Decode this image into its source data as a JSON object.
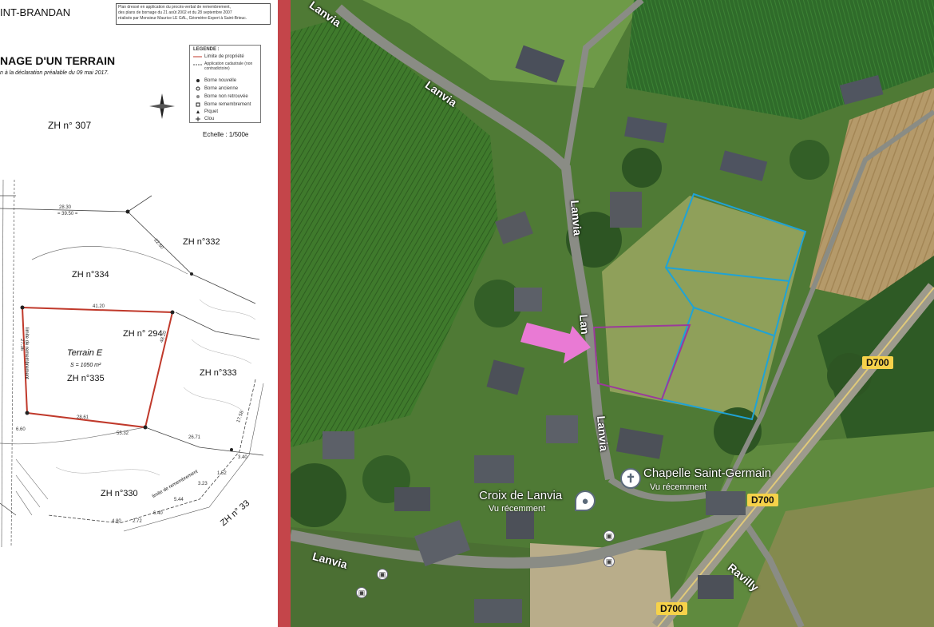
{
  "plan": {
    "commune": "INT-BRANDAN",
    "title": "NAGE D'UN TERRAIN",
    "subtitle": "n à la déclaration préalable du 09 mai 2017.",
    "notice": [
      "Plan dressé en application du procès-verbal de remembrement,",
      "des plans de bornage du 21 août 2002 et du 28 septembre 2007",
      "réalisés par Monsieur Maurice LE GAL, Géomètre-Expert à Saint-Brieuc."
    ],
    "legend_title": "LEGENDE :",
    "legend_items": [
      "Limite de propriété",
      "Application cadastrale (non contradictoire)",
      "Borne nouvelle",
      "Borne ancienne",
      "Borne non retrouvée",
      "Borne remembrement",
      "Piquet",
      "Clou"
    ],
    "scale": "Echelle : 1/500e",
    "parcels": {
      "zh307": "ZH n° 307",
      "zh332": "ZH n°332",
      "zh334": "ZH n°334",
      "zh294": "ZH n° 294",
      "terrain": "Terrain E",
      "surface": "S = 1050 m²",
      "zh335": "ZH n°335",
      "zh333": "ZH n°333",
      "zh330": "ZH n°330",
      "zh33": "ZH n° 33"
    },
    "edge_labels": [
      "limite de remembrement",
      "limite de remembrement"
    ],
    "dims": [
      "28.30",
      "= 39.50 =",
      "41.20",
      "22.50",
      "28.61",
      "55.32",
      "26.71",
      "48.20",
      "27.36",
      "6.60",
      "17.58",
      "1.52",
      "5.44",
      "3.23",
      "4.80",
      "2.72",
      "6.40",
      "3.40"
    ]
  },
  "aerial": {
    "roads": {
      "lanvia_top": "Lanvia",
      "lanvia_vertical": "Lanvia",
      "lanvia_mid": "Lan",
      "lanvia_lower": "Lanvia",
      "lanvia_bottom": "Lanvia",
      "ravilly": "Ravilly"
    },
    "route_tags": [
      "D700",
      "D700",
      "D700"
    ],
    "places": [
      {
        "name": "Chapelle Saint-Germain",
        "note": "Vu récemment"
      },
      {
        "name": "Croix de Lanvia",
        "note": "Vu récemment"
      }
    ],
    "pin_glyphs": [
      "✝",
      "●"
    ],
    "bus_glyph": "▣",
    "colors": {
      "parcel_outline": "#9b3a9b",
      "plots_outline": "#1fa3d6",
      "arrow": "#e97ad4",
      "divider": "#c4454a",
      "route_tag": "#f6d24a"
    }
  }
}
